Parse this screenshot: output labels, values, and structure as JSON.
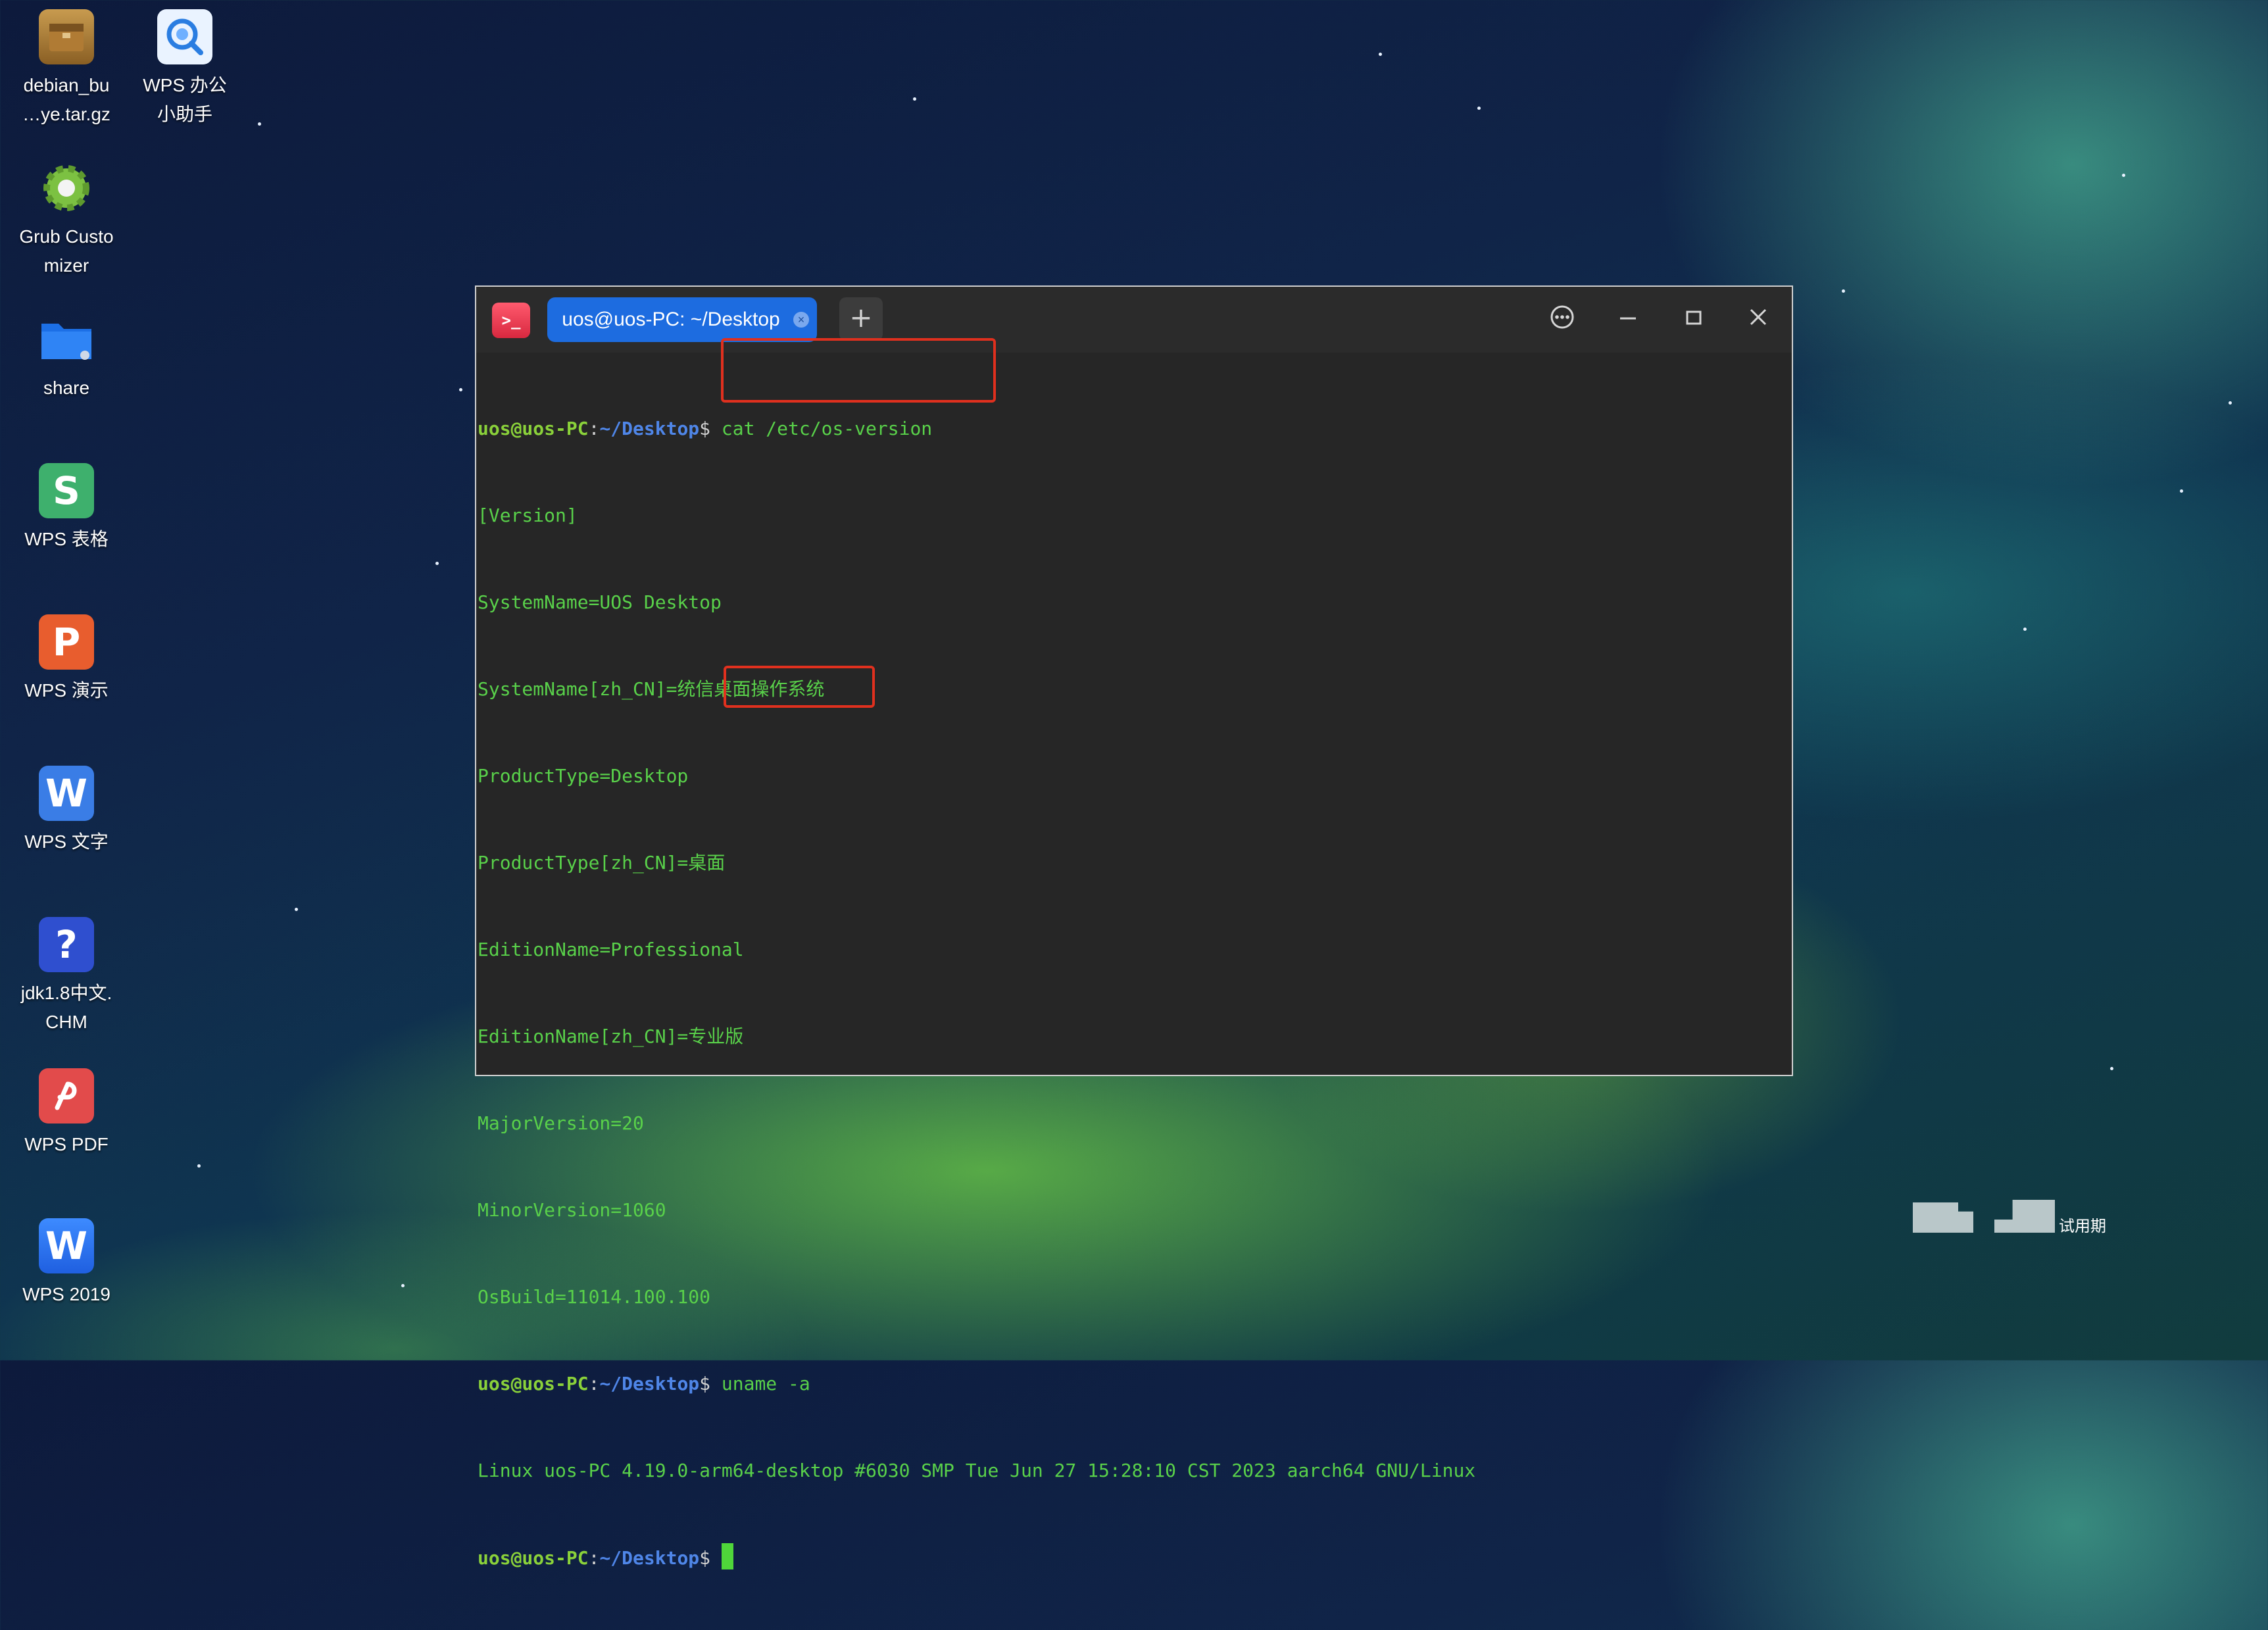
{
  "desktop": {
    "icons": [
      {
        "label_lines": [
          "debian_bu",
          "…ye.tar.gz"
        ],
        "icon": "archive-icon"
      },
      {
        "label_lines": [
          "WPS 办公",
          "小助手"
        ],
        "icon": "search-assistant-icon"
      },
      {
        "label_lines": [
          "Grub Custo",
          "mizer"
        ],
        "icon": "gear-icon"
      },
      {
        "label_lines": [
          "share"
        ],
        "icon": "folder-icon"
      },
      {
        "label_lines": [
          "WPS 表格"
        ],
        "icon": "wps-spreadsheet-icon"
      },
      {
        "label_lines": [
          "WPS 演示"
        ],
        "icon": "wps-presentation-icon"
      },
      {
        "label_lines": [
          "WPS 文字"
        ],
        "icon": "wps-writer-icon"
      },
      {
        "label_lines": [
          "jdk1.8中文.",
          "CHM"
        ],
        "icon": "help-icon"
      },
      {
        "label_lines": [
          "WPS PDF"
        ],
        "icon": "wps-pdf-icon"
      },
      {
        "label_lines": [
          "WPS 2019"
        ],
        "icon": "wps-office-icon"
      }
    ],
    "glyphs": {
      "spreadsheet": "S",
      "presentation": "P",
      "writer": "W",
      "help": "?",
      "office": "W"
    }
  },
  "terminal": {
    "app_icon_text": ">_",
    "tab_title": "uos@uos-PC: ~/Desktop",
    "tab_close": "×",
    "new_tab": "+",
    "prompt": {
      "user": "uos@uos-PC",
      "colon": ":",
      "path": "~/Desktop",
      "dollar": "$"
    },
    "command1": "cat /etc/os-version",
    "output1": [
      "[Version]",
      "SystemName=UOS Desktop",
      "SystemName[zh_CN]=统信桌面操作系统",
      "ProductType=Desktop",
      "ProductType[zh_CN]=桌面",
      "EditionName=Professional",
      "EditionName[zh_CN]=专业版",
      "MajorVersion=20",
      "MinorVersion=1060",
      "OsBuild=11014.100.100"
    ],
    "command2": "uname -a",
    "output2": "Linux uos-PC 4.19.0-arm64-desktop #6030 SMP Tue Jun 27 15:28:10 CST 2023 aarch64 GNU/Linux"
  },
  "tray": {
    "trial_text": "试用期"
  },
  "colors": {
    "accent": "#1d6ce0",
    "highlight": "#e0301e",
    "terminal_text": "#59d14a"
  }
}
